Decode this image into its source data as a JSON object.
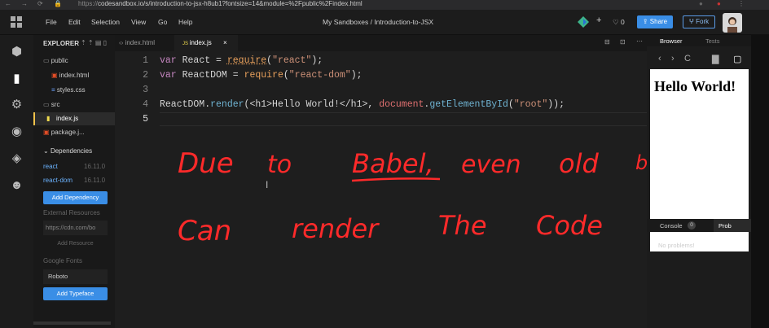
{
  "browser": {
    "url_prefix": "https://",
    "url": "codesandbox.io/s/introduction-to-jsx-h8ub1?fontsize=14&module=%2Fpublic%2Findex.html"
  },
  "topbar": {
    "menu": [
      "File",
      "Edit",
      "Selection",
      "View",
      "Go",
      "Help"
    ],
    "title": "My Sandboxes / Introduction-to-JSX",
    "like_count": "0",
    "share_label": "Share",
    "fork_label": "Fork"
  },
  "explorer": {
    "title": "EXPLORER",
    "files": [
      {
        "name": "public",
        "kind": "folder"
      },
      {
        "name": "index.html",
        "kind": "html"
      },
      {
        "name": "styles.css",
        "kind": "css"
      },
      {
        "name": "src",
        "kind": "folder"
      },
      {
        "name": "index.js",
        "kind": "js"
      },
      {
        "name": "package.j...",
        "kind": "json"
      }
    ],
    "dependencies_title": "Dependencies",
    "dependencies": [
      {
        "name": "react",
        "version": "16.11.0"
      },
      {
        "name": "react-dom",
        "version": "16.11.0"
      }
    ],
    "add_dependency": "Add Dependency",
    "external_resources": "External Resources",
    "resource_placeholder": "https://cdn.com/bo",
    "add_resource": "Add Resource",
    "google_fonts": "Google Fonts",
    "font_value": "Roboto",
    "add_typeface": "Add Typeface"
  },
  "tabs": [
    {
      "label": "index.html",
      "icon": "html-icon"
    },
    {
      "label": "index.js",
      "icon": "js-icon",
      "active": true
    }
  ],
  "code": {
    "line_numbers": [
      "1",
      "2",
      "3",
      "4",
      "5"
    ],
    "line1": {
      "kw": "var",
      "name": "React",
      "eq": "=",
      "fn": "require",
      "str": "\"react\""
    },
    "line2": {
      "kw": "var",
      "name": "ReactDOM",
      "eq": "=",
      "fn": "require",
      "str": "\"react-dom\""
    },
    "line4": {
      "obj": "ReactDOM",
      "method": "render",
      "jsx": "<h1>Hello World!</h1>",
      "doc": "document",
      "getter": "getElementById",
      "str": "\"root\""
    }
  },
  "annotation": {
    "line1_words": [
      "Due",
      "to",
      "Babel,",
      "even",
      "old",
      "browsers"
    ],
    "line2_words": [
      "Can",
      "render",
      "The",
      "Code"
    ],
    "color": "#ff2a2a"
  },
  "preview": {
    "tab_browser": "Browser",
    "tab_tests": "Tests",
    "heading": "Hello World!",
    "console_tab": "Console",
    "console_count": "0",
    "problems_tab": "Prob",
    "problems_message": "No problems!"
  }
}
